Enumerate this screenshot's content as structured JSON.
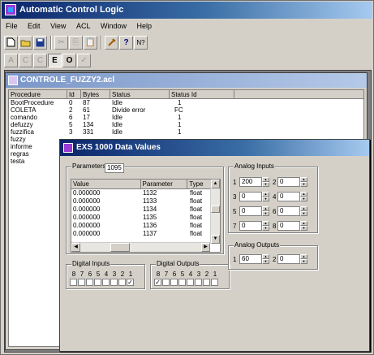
{
  "app": {
    "title": "Automatic Control Logic",
    "menu": [
      "File",
      "Edit",
      "View",
      "ACL",
      "Window",
      "Help"
    ],
    "toolbar2_letters": [
      "A",
      "C",
      "C",
      "E",
      "O",
      "✓"
    ]
  },
  "child": {
    "title": "CONTROLE_FUZZY2.acl",
    "headers": [
      "Procedure",
      "Id",
      "Bytes",
      "Status",
      "Status Id"
    ],
    "rows": [
      [
        "BootProcedure",
        "0",
        "87",
        "Idle",
        "1"
      ],
      [
        "COLETA",
        "2",
        "61",
        "Divide error",
        "FC"
      ],
      [
        "comando",
        "6",
        "17",
        "Idle",
        "1"
      ],
      [
        "defuzzy",
        "5",
        "134",
        "Idle",
        "1"
      ],
      [
        "fuzzifica",
        "3",
        "331",
        "Idle",
        "1"
      ],
      [
        "fuzzy",
        "",
        "",
        "",
        ""
      ],
      [
        "informe",
        "",
        "",
        "",
        ""
      ],
      [
        "regras",
        "",
        "",
        "",
        ""
      ],
      [
        "testa",
        "",
        "",
        "",
        ""
      ]
    ]
  },
  "dialog": {
    "title": "EXS 1000 Data Values",
    "parameters_label": "Parameters",
    "parameters_value": "1095",
    "table_headers": [
      "Value",
      "Parameter",
      "Type"
    ],
    "table_rows": [
      [
        "0.000000",
        "1132",
        "float"
      ],
      [
        "0.000000",
        "1133",
        "float"
      ],
      [
        "0.000000",
        "1134",
        "float"
      ],
      [
        "0.000000",
        "1135",
        "float"
      ],
      [
        "0.000000",
        "1136",
        "float"
      ],
      [
        "0.000000",
        "1137",
        "float"
      ]
    ],
    "digital_inputs": {
      "label": "Digital Inputs",
      "bits": [
        "8",
        "7",
        "6",
        "5",
        "4",
        "3",
        "2",
        "1"
      ],
      "checked": [
        false,
        false,
        false,
        false,
        false,
        false,
        false,
        true
      ]
    },
    "digital_outputs": {
      "label": "Digital Outputs",
      "bits": [
        "8",
        "7",
        "6",
        "5",
        "4",
        "3",
        "2",
        "1"
      ],
      "checked": [
        true,
        false,
        false,
        false,
        false,
        false,
        false,
        false
      ]
    },
    "analog_inputs": {
      "label": "Analog Inputs",
      "rows": [
        {
          "a": "1",
          "av": "200",
          "b": "2",
          "bv": "0"
        },
        {
          "a": "3",
          "av": "0",
          "b": "4",
          "bv": "0"
        },
        {
          "a": "5",
          "av": "0",
          "b": "6",
          "bv": "0"
        },
        {
          "a": "7",
          "av": "0",
          "b": "8",
          "bv": "0"
        }
      ]
    },
    "analog_outputs": {
      "label": "Analog Outputs",
      "rows": [
        {
          "a": "1",
          "av": "60",
          "b": "2",
          "bv": "0"
        }
      ]
    }
  }
}
